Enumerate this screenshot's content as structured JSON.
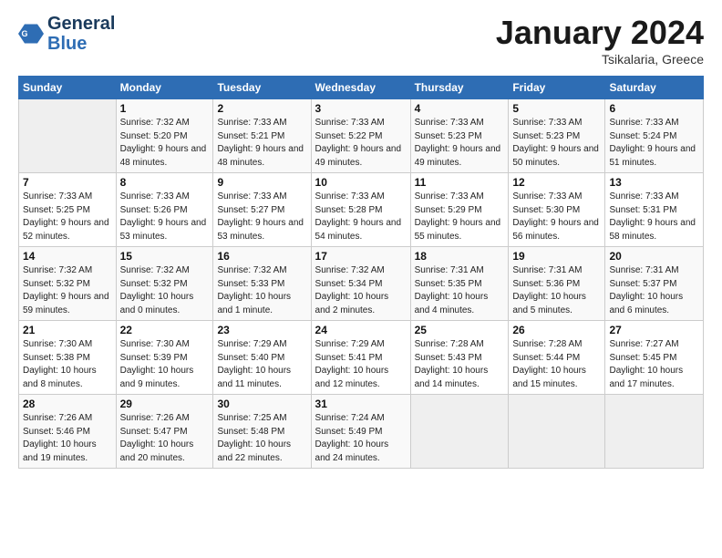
{
  "header": {
    "logo_line1": "General",
    "logo_line2": "Blue",
    "month": "January 2024",
    "location": "Tsikalaria, Greece"
  },
  "weekdays": [
    "Sunday",
    "Monday",
    "Tuesday",
    "Wednesday",
    "Thursday",
    "Friday",
    "Saturday"
  ],
  "weeks": [
    [
      {
        "day": "",
        "empty": true
      },
      {
        "day": "1",
        "sunrise": "7:32 AM",
        "sunset": "5:20 PM",
        "daylight": "9 hours and 48 minutes."
      },
      {
        "day": "2",
        "sunrise": "7:33 AM",
        "sunset": "5:21 PM",
        "daylight": "9 hours and 48 minutes."
      },
      {
        "day": "3",
        "sunrise": "7:33 AM",
        "sunset": "5:22 PM",
        "daylight": "9 hours and 49 minutes."
      },
      {
        "day": "4",
        "sunrise": "7:33 AM",
        "sunset": "5:23 PM",
        "daylight": "9 hours and 49 minutes."
      },
      {
        "day": "5",
        "sunrise": "7:33 AM",
        "sunset": "5:23 PM",
        "daylight": "9 hours and 50 minutes."
      },
      {
        "day": "6",
        "sunrise": "7:33 AM",
        "sunset": "5:24 PM",
        "daylight": "9 hours and 51 minutes."
      }
    ],
    [
      {
        "day": "7",
        "sunrise": "7:33 AM",
        "sunset": "5:25 PM",
        "daylight": "9 hours and 52 minutes."
      },
      {
        "day": "8",
        "sunrise": "7:33 AM",
        "sunset": "5:26 PM",
        "daylight": "9 hours and 53 minutes."
      },
      {
        "day": "9",
        "sunrise": "7:33 AM",
        "sunset": "5:27 PM",
        "daylight": "9 hours and 53 minutes."
      },
      {
        "day": "10",
        "sunrise": "7:33 AM",
        "sunset": "5:28 PM",
        "daylight": "9 hours and 54 minutes."
      },
      {
        "day": "11",
        "sunrise": "7:33 AM",
        "sunset": "5:29 PM",
        "daylight": "9 hours and 55 minutes."
      },
      {
        "day": "12",
        "sunrise": "7:33 AM",
        "sunset": "5:30 PM",
        "daylight": "9 hours and 56 minutes."
      },
      {
        "day": "13",
        "sunrise": "7:33 AM",
        "sunset": "5:31 PM",
        "daylight": "9 hours and 58 minutes."
      }
    ],
    [
      {
        "day": "14",
        "sunrise": "7:32 AM",
        "sunset": "5:32 PM",
        "daylight": "9 hours and 59 minutes."
      },
      {
        "day": "15",
        "sunrise": "7:32 AM",
        "sunset": "5:32 PM",
        "daylight": "10 hours and 0 minutes."
      },
      {
        "day": "16",
        "sunrise": "7:32 AM",
        "sunset": "5:33 PM",
        "daylight": "10 hours and 1 minute."
      },
      {
        "day": "17",
        "sunrise": "7:32 AM",
        "sunset": "5:34 PM",
        "daylight": "10 hours and 2 minutes."
      },
      {
        "day": "18",
        "sunrise": "7:31 AM",
        "sunset": "5:35 PM",
        "daylight": "10 hours and 4 minutes."
      },
      {
        "day": "19",
        "sunrise": "7:31 AM",
        "sunset": "5:36 PM",
        "daylight": "10 hours and 5 minutes."
      },
      {
        "day": "20",
        "sunrise": "7:31 AM",
        "sunset": "5:37 PM",
        "daylight": "10 hours and 6 minutes."
      }
    ],
    [
      {
        "day": "21",
        "sunrise": "7:30 AM",
        "sunset": "5:38 PM",
        "daylight": "10 hours and 8 minutes."
      },
      {
        "day": "22",
        "sunrise": "7:30 AM",
        "sunset": "5:39 PM",
        "daylight": "10 hours and 9 minutes."
      },
      {
        "day": "23",
        "sunrise": "7:29 AM",
        "sunset": "5:40 PM",
        "daylight": "10 hours and 11 minutes."
      },
      {
        "day": "24",
        "sunrise": "7:29 AM",
        "sunset": "5:41 PM",
        "daylight": "10 hours and 12 minutes."
      },
      {
        "day": "25",
        "sunrise": "7:28 AM",
        "sunset": "5:43 PM",
        "daylight": "10 hours and 14 minutes."
      },
      {
        "day": "26",
        "sunrise": "7:28 AM",
        "sunset": "5:44 PM",
        "daylight": "10 hours and 15 minutes."
      },
      {
        "day": "27",
        "sunrise": "7:27 AM",
        "sunset": "5:45 PM",
        "daylight": "10 hours and 17 minutes."
      }
    ],
    [
      {
        "day": "28",
        "sunrise": "7:26 AM",
        "sunset": "5:46 PM",
        "daylight": "10 hours and 19 minutes."
      },
      {
        "day": "29",
        "sunrise": "7:26 AM",
        "sunset": "5:47 PM",
        "daylight": "10 hours and 20 minutes."
      },
      {
        "day": "30",
        "sunrise": "7:25 AM",
        "sunset": "5:48 PM",
        "daylight": "10 hours and 22 minutes."
      },
      {
        "day": "31",
        "sunrise": "7:24 AM",
        "sunset": "5:49 PM",
        "daylight": "10 hours and 24 minutes."
      },
      {
        "day": "",
        "empty": true
      },
      {
        "day": "",
        "empty": true
      },
      {
        "day": "",
        "empty": true
      }
    ]
  ]
}
